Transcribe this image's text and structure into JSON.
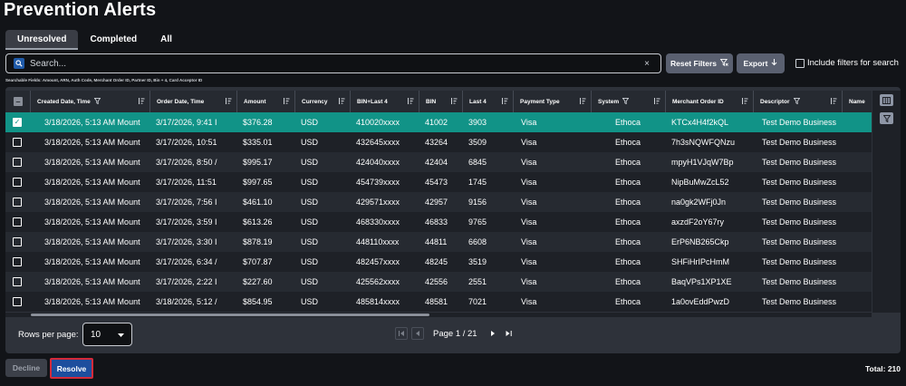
{
  "page": {
    "title": "Prevention Alerts"
  },
  "tabs": [
    {
      "label": "Unresolved"
    },
    {
      "label": "Completed"
    },
    {
      "label": "All"
    }
  ],
  "search": {
    "placeholder": "Search...",
    "clear_glyph": "×",
    "hint": "Searchable Fields: Amount, ARN, Auth Code, Merchant Order ID, Partner ID, Bin + 4, Card Acceptor ID"
  },
  "toolbar": {
    "reset_label": "Reset Filters",
    "export_label": "Export",
    "include_label": "Include filters for search"
  },
  "table": {
    "columns": [
      {
        "label": "Created Date, Time",
        "filter": true
      },
      {
        "label": "Order Date, Time",
        "filter": false
      },
      {
        "label": "Amount",
        "filter": false
      },
      {
        "label": "Currency",
        "filter": false
      },
      {
        "label": "BIN+Last 4",
        "filter": false
      },
      {
        "label": "BIN",
        "filter": false
      },
      {
        "label": "Last 4",
        "filter": false
      },
      {
        "label": "Payment Type",
        "filter": false
      },
      {
        "label": "System",
        "filter": true
      },
      {
        "label": "Merchant Order ID",
        "filter": false
      },
      {
        "label": "Descriptor",
        "filter": true
      },
      {
        "label": "Name",
        "filter": false
      }
    ],
    "rows": [
      {
        "selected": true,
        "created": "3/18/2026, 5:13 AM Mount",
        "order": "3/17/2026, 9:41 I",
        "amount": "$376.28",
        "currency": "USD",
        "binlast4": "410020xxxx",
        "bin": "41002",
        "last4": "3903",
        "payment": "Visa",
        "system": "Ethoca",
        "merchant_order": "KTCx4H4f2kQL",
        "descriptor": "Test Demo Business"
      },
      {
        "selected": false,
        "created": "3/18/2026, 5:13 AM Mount",
        "order": "3/17/2026, 10:51",
        "amount": "$335.01",
        "currency": "USD",
        "binlast4": "432645xxxx",
        "bin": "43264",
        "last4": "3509",
        "payment": "Visa",
        "system": "Ethoca",
        "merchant_order": "7h3sNQWFQNzu",
        "descriptor": "Test Demo Business"
      },
      {
        "selected": false,
        "created": "3/18/2026, 5:13 AM Mount",
        "order": "3/17/2026, 8:50 /",
        "amount": "$995.17",
        "currency": "USD",
        "binlast4": "424040xxxx",
        "bin": "42404",
        "last4": "6845",
        "payment": "Visa",
        "system": "Ethoca",
        "merchant_order": "mpyH1VJqW7Bp",
        "descriptor": "Test Demo Business"
      },
      {
        "selected": false,
        "created": "3/18/2026, 5:13 AM Mount",
        "order": "3/17/2026, 11:51",
        "amount": "$997.65",
        "currency": "USD",
        "binlast4": "454739xxxx",
        "bin": "45473",
        "last4": "1745",
        "payment": "Visa",
        "system": "Ethoca",
        "merchant_order": "NipBuMwZcL52",
        "descriptor": "Test Demo Business"
      },
      {
        "selected": false,
        "created": "3/18/2026, 5:13 AM Mount",
        "order": "3/17/2026, 7:56 I",
        "amount": "$461.10",
        "currency": "USD",
        "binlast4": "429571xxxx",
        "bin": "42957",
        "last4": "9156",
        "payment": "Visa",
        "system": "Ethoca",
        "merchant_order": "na0gk2WFj0Jn",
        "descriptor": "Test Demo Business"
      },
      {
        "selected": false,
        "created": "3/18/2026, 5:13 AM Mount",
        "order": "3/17/2026, 3:59 I",
        "amount": "$613.26",
        "currency": "USD",
        "binlast4": "468330xxxx",
        "bin": "46833",
        "last4": "9765",
        "payment": "Visa",
        "system": "Ethoca",
        "merchant_order": "axzdF2oY67ry",
        "descriptor": "Test Demo Business"
      },
      {
        "selected": false,
        "created": "3/18/2026, 5:13 AM Mount",
        "order": "3/17/2026, 3:30 I",
        "amount": "$878.19",
        "currency": "USD",
        "binlast4": "448110xxxx",
        "bin": "44811",
        "last4": "6608",
        "payment": "Visa",
        "system": "Ethoca",
        "merchant_order": "ErP6NB265Ckp",
        "descriptor": "Test Demo Business"
      },
      {
        "selected": false,
        "created": "3/18/2026, 5:13 AM Mount",
        "order": "3/17/2026, 6:34 /",
        "amount": "$707.87",
        "currency": "USD",
        "binlast4": "482457xxxx",
        "bin": "48245",
        "last4": "3519",
        "payment": "Visa",
        "system": "Ethoca",
        "merchant_order": "SHFiHrIPcHmM",
        "descriptor": "Test Demo Business"
      },
      {
        "selected": false,
        "created": "3/18/2026, 5:13 AM Mount",
        "order": "3/17/2026, 2:22 I",
        "amount": "$227.60",
        "currency": "USD",
        "binlast4": "425562xxxx",
        "bin": "42556",
        "last4": "2551",
        "payment": "Visa",
        "system": "Ethoca",
        "merchant_order": "BaqVPs1XP1XE",
        "descriptor": "Test Demo Business"
      },
      {
        "selected": false,
        "created": "3/18/2026, 5:13 AM Mount",
        "order": "3/18/2026, 5:12 /",
        "amount": "$854.95",
        "currency": "USD",
        "binlast4": "485814xxxx",
        "bin": "48581",
        "last4": "7021",
        "payment": "Visa",
        "system": "Ethoca",
        "merchant_order": "1a0ovEddPwzD",
        "descriptor": "Test Demo Business"
      }
    ]
  },
  "pagination": {
    "rows_per_page_label": "Rows per page:",
    "rows_per_page_value": "10",
    "page_text": "Page 1 / 21"
  },
  "footer": {
    "decline_label": "Decline",
    "resolve_label": "Resolve",
    "total_text": "Total: 210"
  },
  "colors": {
    "background": "#121418",
    "selected_row": "#119387",
    "resolve_button": "#1d4e9e",
    "resolve_outline": "#d42a3a"
  }
}
